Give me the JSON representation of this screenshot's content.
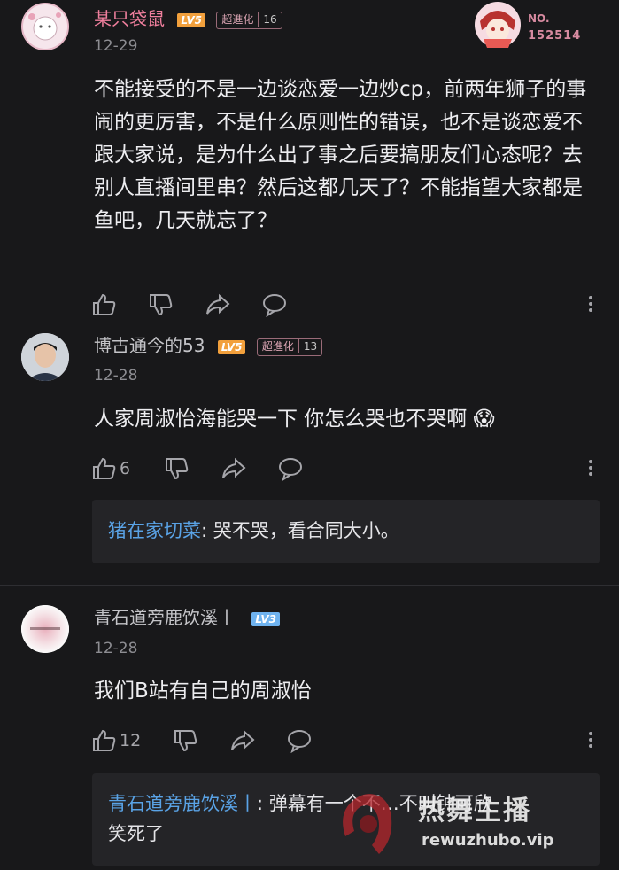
{
  "comments": [
    {
      "username": "某只袋鼠",
      "level": "LV5",
      "medal_name": "超進化",
      "medal_level": "16",
      "date": "12-29",
      "text": "不能接受的不是一边谈恋爱一边炒cp，前两年狮子的事闹的更厉害，不是什么原则性的错误，也不是谈恋爱不跟大家说，是为什么出了事之后要搞朋友们心态呢？去别人直播间里串？然后这都几天了？不能指望大家都是鱼吧，几天就忘了？",
      "badge_no_label": "NO.",
      "badge_no_value": "152514",
      "like_count": ""
    },
    {
      "username": "博古通今的53",
      "level": "LV5",
      "medal_name": "超進化",
      "medal_level": "13",
      "date": "12-28",
      "text": "人家周淑怡海能哭一下 你怎么哭也不哭啊",
      "emoji": "😱",
      "like_count": "6",
      "reply": {
        "name": "猪在家切菜",
        "text": ": 哭不哭，看合同大小。"
      }
    },
    {
      "username": "青石道旁鹿饮溪丨",
      "level": "LV3",
      "date": "12-28",
      "text": "我们B站有自己的周淑怡",
      "like_count": "12",
      "reply": {
        "name": "青石道旁鹿饮溪丨",
        "text": ": 弹幕有一个不…不叫钟可欣",
        "text2": "笑死了"
      }
    }
  ],
  "watermark": {
    "title": "热舞主播",
    "url": "rewuzhubo.vip"
  },
  "colors": {
    "background": "#18181a",
    "level5": "#f2a03c",
    "level3": "#6fb3f0",
    "reply_name": "#5aa3e6"
  },
  "icons": [
    "thumb-up-icon",
    "thumb-down-icon",
    "share-icon",
    "comment-icon",
    "more-vertical-icon"
  ]
}
